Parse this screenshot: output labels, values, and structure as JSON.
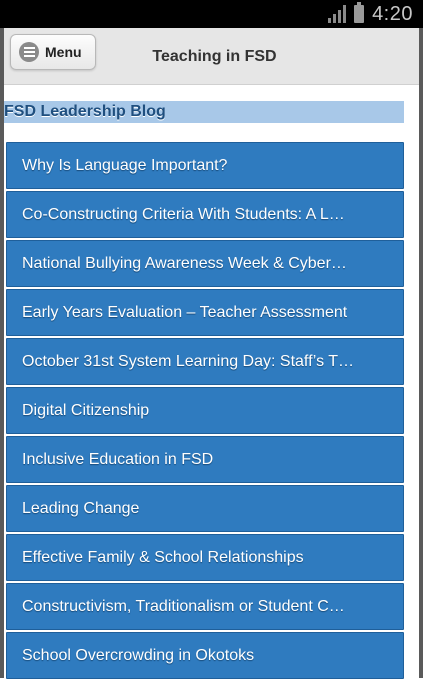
{
  "status_bar": {
    "time": "4:20"
  },
  "header": {
    "menu_label": "Menu",
    "title": "Teaching in FSD"
  },
  "section": {
    "heading": "FSD Leadership Blog"
  },
  "posts": [
    {
      "title": "Why Is Language Important?"
    },
    {
      "title": "Co-Constructing Criteria With Students: A L…"
    },
    {
      "title": "National Bullying Awareness Week & Cyber…"
    },
    {
      "title": "Early Years Evaluation – Teacher Assessment"
    },
    {
      "title": "October 31st System Learning Day: Staff’s T…"
    },
    {
      "title": "Digital Citizenship"
    },
    {
      "title": "Inclusive Education in FSD"
    },
    {
      "title": "Leading Change"
    },
    {
      "title": "Effective Family & School Relationships"
    },
    {
      "title": "Constructivism, Traditionalism or Student C…"
    },
    {
      "title": "School Overcrowding in Okotoks"
    }
  ],
  "colors": {
    "status_bar": "#000000",
    "header": "#e6e6e6",
    "heading_band": "#a8c8e8",
    "list_item": "#2f7bbf"
  }
}
